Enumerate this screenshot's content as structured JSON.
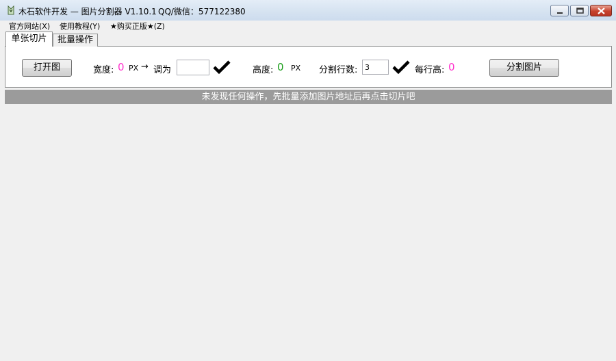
{
  "window": {
    "title": "木石软件开发 — 图片分割器 V1.10.1",
    "contact": "QQ/微信：577122380"
  },
  "menu": [
    {
      "label": "官方网站(X)"
    },
    {
      "label": "使用教程(Y)"
    },
    {
      "label": "★购买正版★(Z)"
    }
  ],
  "tabs": [
    {
      "label": "单张切片",
      "active": true
    },
    {
      "label": "批量操作",
      "active": false
    }
  ],
  "panel": {
    "open_button": "打开图",
    "width_label": "宽度:",
    "width_value": "0",
    "px_unit": "PX",
    "arrow": "→",
    "adjust_label": "调为",
    "width_input_value": "",
    "height_label": "高度:",
    "height_value": "0",
    "rows_label": "分割行数:",
    "rows_input_value": "3",
    "row_height_label": "每行高:",
    "row_height_value": "0",
    "split_button": "分割图片"
  },
  "status": {
    "message": "未发现任何操作，先批量添加图片地址后再点击切片吧"
  },
  "colors": {
    "value_magenta": "#ff33cc",
    "value_green": "#1a9e1a",
    "status_bg": "#9b9b9b"
  },
  "icons": [
    "app-icon",
    "minimize-icon",
    "maximize-icon",
    "close-icon",
    "checkmark-icon"
  ]
}
